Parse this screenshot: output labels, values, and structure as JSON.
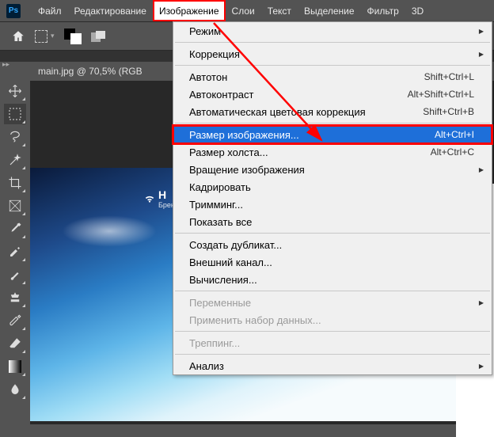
{
  "menubar": {
    "items": [
      "Файл",
      "Редактирование",
      "Изображение",
      "Слои",
      "Текст",
      "Выделение",
      "Фильтр",
      "3D"
    ]
  },
  "doc_tab": "main.jpg @ 70,5% (RGB",
  "ps_logo": "Ps",
  "wifi_label": "Н",
  "wifi_sub": "Бренди",
  "dropdown": {
    "sections": [
      [
        {
          "label": "Режим",
          "sub": true
        }
      ],
      [
        {
          "label": "Коррекция",
          "sub": true
        }
      ],
      [
        {
          "label": "Автотон",
          "shortcut": "Shift+Ctrl+L"
        },
        {
          "label": "Автоконтраст",
          "shortcut": "Alt+Shift+Ctrl+L"
        },
        {
          "label": "Автоматическая цветовая коррекция",
          "shortcut": "Shift+Ctrl+B"
        }
      ],
      [
        {
          "label": "Размер изображения...",
          "shortcut": "Alt+Ctrl+I",
          "hl": true
        },
        {
          "label": "Размер холста...",
          "shortcut": "Alt+Ctrl+C"
        },
        {
          "label": "Вращение изображения",
          "sub": true
        },
        {
          "label": "Кадрировать"
        },
        {
          "label": "Тримминг..."
        },
        {
          "label": "Показать все"
        }
      ],
      [
        {
          "label": "Создать дубликат..."
        },
        {
          "label": "Внешний канал..."
        },
        {
          "label": "Вычисления..."
        }
      ],
      [
        {
          "label": "Переменные",
          "sub": true,
          "disabled": true
        },
        {
          "label": "Применить набор данных...",
          "disabled": true
        }
      ],
      [
        {
          "label": "Треппинг...",
          "disabled": true
        }
      ],
      [
        {
          "label": "Анализ",
          "sub": true
        }
      ]
    ]
  }
}
